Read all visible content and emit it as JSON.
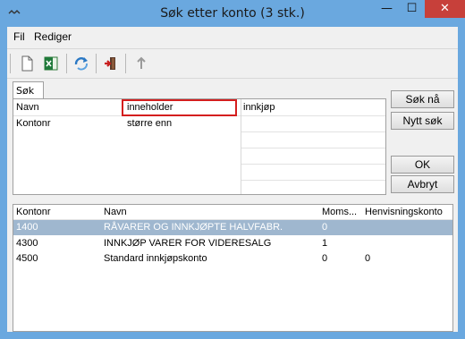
{
  "window": {
    "title": "Søk etter konto (3 stk.)",
    "minimize_glyph": "—",
    "maximize_glyph": "☐",
    "close_glyph": "✕",
    "accent": "#6aa8df"
  },
  "menu": {
    "items": [
      "Fil",
      "Rediger"
    ]
  },
  "toolbar": {
    "icons": [
      "new-document-icon",
      "excel-export-icon",
      "refresh-icon",
      "exit-door-icon",
      "upload-arrow-icon"
    ]
  },
  "search": {
    "tab_label": "Søk",
    "rows": [
      {
        "field": "Navn",
        "operator": "inneholder",
        "value": "innkjøp"
      },
      {
        "field": "Kontonr",
        "operator": "større enn",
        "value": ""
      }
    ]
  },
  "buttons": {
    "search_now": "Søk nå",
    "new_search": "Nytt søk",
    "ok": "OK",
    "cancel": "Avbryt"
  },
  "results": {
    "columns": [
      "Kontonr",
      "Navn",
      "Moms...",
      "Henvisningskonto"
    ],
    "rows": [
      {
        "kontonr": "1400",
        "navn": "RÅVARER OG INNKJØPTE HALVFABR.",
        "moms": "0",
        "henvisning": "",
        "selected": true
      },
      {
        "kontonr": "4300",
        "navn": "INNKJØP VARER FOR VIDERESALG",
        "moms": "1",
        "henvisning": "",
        "selected": false
      },
      {
        "kontonr": "4500",
        "navn": "Standard innkjøpskonto",
        "moms": "0",
        "henvisning": "0",
        "selected": false
      }
    ],
    "selected_color": "#9fb7cf"
  }
}
